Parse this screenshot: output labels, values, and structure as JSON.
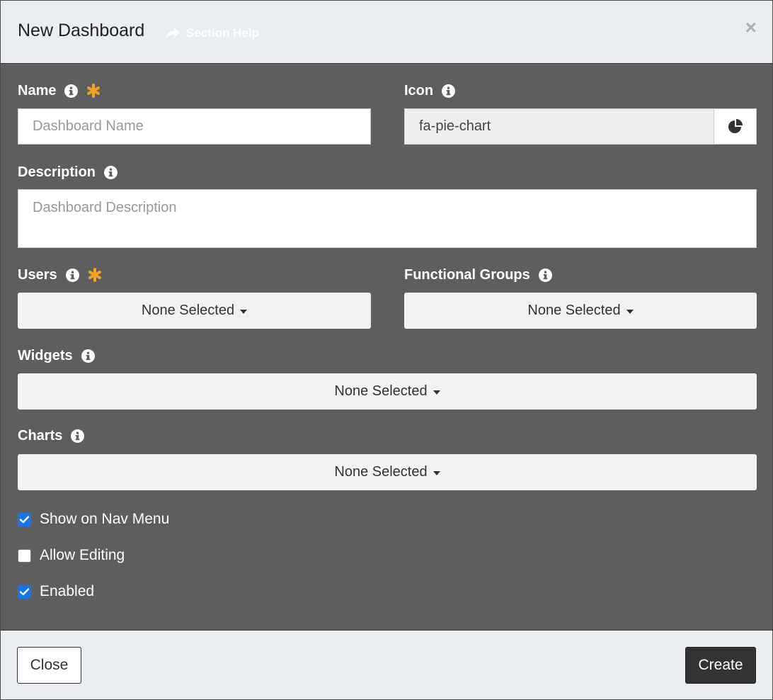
{
  "header": {
    "title": "New Dashboard",
    "help_label": "Section Help",
    "close_symbol": "×"
  },
  "fields": {
    "name": {
      "label": "Name",
      "placeholder": "Dashboard Name",
      "required": true
    },
    "icon": {
      "label": "Icon",
      "value": "fa-pie-chart",
      "preview_icon": "pie-chart-icon"
    },
    "description": {
      "label": "Description",
      "placeholder": "Dashboard Description"
    },
    "users": {
      "label": "Users",
      "value": "None Selected",
      "required": true
    },
    "functional_groups": {
      "label": "Functional Groups",
      "value": "None Selected"
    },
    "widgets": {
      "label": "Widgets",
      "value": "None Selected"
    },
    "charts": {
      "label": "Charts",
      "value": "None Selected"
    }
  },
  "options": [
    {
      "label": "Show on Nav Menu",
      "checked": true
    },
    {
      "label": "Allow Editing",
      "checked": false
    },
    {
      "label": "Enabled",
      "checked": true
    }
  ],
  "footer": {
    "close_label": "Close",
    "create_label": "Create"
  },
  "colors": {
    "background": "#5e5e5e",
    "header_bg": "#eaeef3",
    "required": "#f0a323",
    "checkbox": "#1a73e8",
    "primary_button": "#333333"
  }
}
